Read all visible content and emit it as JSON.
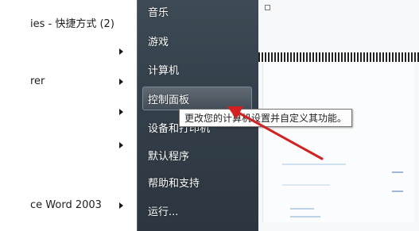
{
  "left_menu": {
    "items": [
      {
        "label": "ies - 快捷方式 (2)",
        "has_submenu": false
      },
      {
        "label": "",
        "has_submenu": true
      },
      {
        "label": "rer",
        "has_submenu": true
      },
      {
        "label": "",
        "has_submenu": true
      },
      {
        "label": "",
        "has_submenu": true
      },
      {
        "label": "ce Word 2003",
        "has_submenu": true
      }
    ]
  },
  "right_menu": {
    "items": [
      {
        "label": "音乐"
      },
      {
        "label": "游戏"
      },
      {
        "label": "计算机"
      },
      {
        "label": "控制面板",
        "selected": true
      },
      {
        "label": "设备和打印机"
      },
      {
        "label": "默认程序"
      },
      {
        "label": "帮助和支持"
      },
      {
        "label": "运行..."
      }
    ]
  },
  "tooltip": {
    "text": "更改您的计算机设置并自定义其功能。"
  },
  "colors": {
    "right_pane_bg": "#34404b",
    "annotation_arrow": "#d62020",
    "tooltip_border": "#767676"
  }
}
